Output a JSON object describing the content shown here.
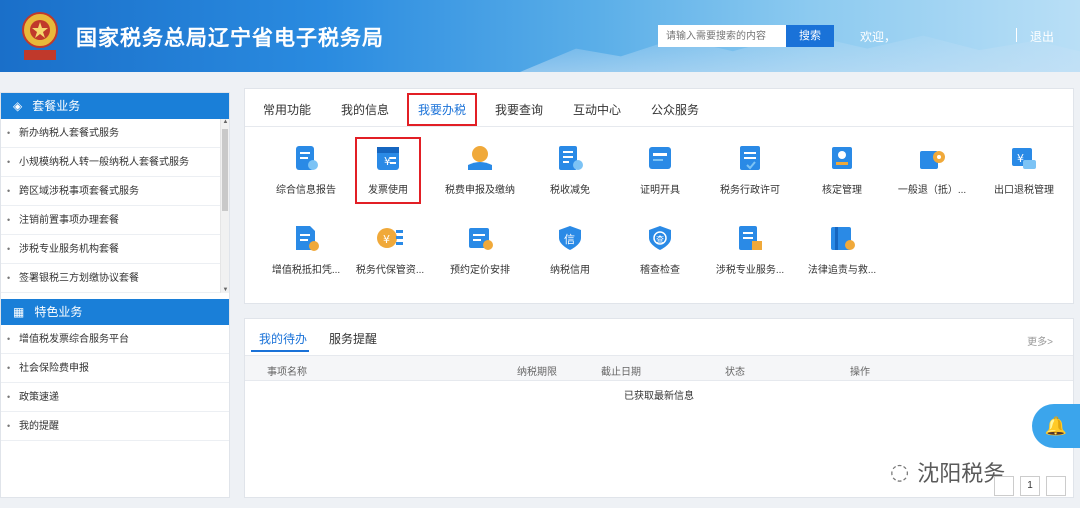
{
  "header": {
    "title": "国家税务总局辽宁省电子税务局",
    "search_placeholder": "请输入需要搜索的内容",
    "search_button": "搜索",
    "welcome": "欢迎，",
    "logout": "退出"
  },
  "sidebar": {
    "section1_title": "套餐业务",
    "section1_items": [
      "新办纳税人套餐式服务",
      "小规模纳税人转一般纳税人套餐式服务",
      "跨区域涉税事项套餐式服务",
      "注销前置事项办理套餐",
      "涉税专业服务机构套餐",
      "签署银税三方划缴协议套餐"
    ],
    "section2_title": "特色业务",
    "section2_items": [
      "增值税发票综合服务平台",
      "社会保险费申报",
      "政策速递",
      "我的提醒"
    ]
  },
  "main_tabs": [
    "常用功能",
    "我的信息",
    "我要办税",
    "我要查询",
    "互动中心",
    "公众服务"
  ],
  "active_tab": "我要办税",
  "services_row1": [
    {
      "label": "综合信息报告",
      "icon": "report-icon"
    },
    {
      "label": "发票使用",
      "icon": "invoice-icon"
    },
    {
      "label": "税费申报及缴纳",
      "icon": "tax-payment-icon"
    },
    {
      "label": "税收减免",
      "icon": "tax-reduction-icon"
    },
    {
      "label": "证明开具",
      "icon": "certificate-icon"
    },
    {
      "label": "税务行政许可",
      "icon": "license-icon"
    },
    {
      "label": "核定管理",
      "icon": "assessment-icon"
    },
    {
      "label": "一般退（抵）...",
      "icon": "refund-icon"
    },
    {
      "label": "出口退税管理",
      "icon": "export-rebate-icon"
    }
  ],
  "services_row2": [
    {
      "label": "增值税抵扣凭...",
      "icon": "vat-deduction-icon"
    },
    {
      "label": "税务代保管资...",
      "icon": "custody-icon"
    },
    {
      "label": "预约定价安排",
      "icon": "pricing-icon"
    },
    {
      "label": "纳税信用",
      "icon": "credit-icon"
    },
    {
      "label": "稽查检查",
      "icon": "inspection-icon"
    },
    {
      "label": "涉税专业服务...",
      "icon": "professional-service-icon"
    },
    {
      "label": "法律追责与救...",
      "icon": "legal-icon"
    }
  ],
  "todo": {
    "tab1": "我的待办",
    "tab2": "服务提醒",
    "more": "更多>",
    "columns": [
      "事项名称",
      "纳税期限",
      "截止日期",
      "状态",
      "操作"
    ],
    "empty_text": "已获取最新信息"
  },
  "watermark": "沈阳税务",
  "pager_current": "1",
  "colors": {
    "primary": "#1a7fd8",
    "highlight": "#e21f25",
    "icon": "#2a8ae6"
  }
}
